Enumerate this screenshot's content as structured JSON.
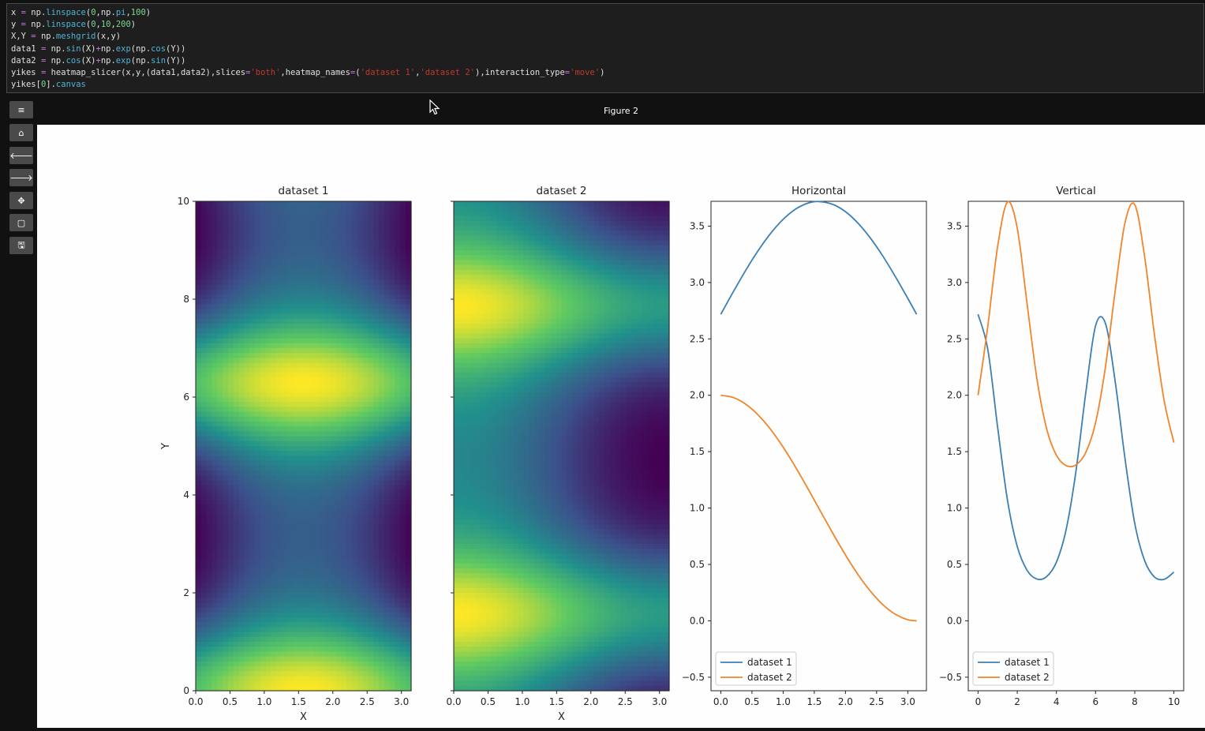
{
  "code_lines": [
    [
      [
        "x ",
        ""
      ],
      [
        "=",
        "op"
      ],
      [
        " np.",
        ""
      ],
      [
        "linspace",
        "fn"
      ],
      [
        "(",
        ""
      ],
      [
        "0",
        "num"
      ],
      [
        ",np.",
        ""
      ],
      [
        "pi",
        "fn"
      ],
      [
        ",",
        ""
      ],
      [
        "100",
        "num"
      ],
      [
        ")",
        ""
      ]
    ],
    [
      [
        "y ",
        ""
      ],
      [
        "=",
        "op"
      ],
      [
        " np.",
        ""
      ],
      [
        "linspace",
        "fn"
      ],
      [
        "(",
        ""
      ],
      [
        "0",
        "num"
      ],
      [
        ",",
        ""
      ],
      [
        "10",
        "num"
      ],
      [
        ",",
        ""
      ],
      [
        "200",
        "num"
      ],
      [
        ")",
        ""
      ]
    ],
    [
      [
        "X,Y ",
        ""
      ],
      [
        "=",
        "op"
      ],
      [
        " np.",
        ""
      ],
      [
        "meshgrid",
        "fn"
      ],
      [
        "(x,y)",
        ""
      ]
    ],
    [
      [
        "data1 ",
        ""
      ],
      [
        "=",
        "op"
      ],
      [
        " np.",
        ""
      ],
      [
        "sin",
        "fn"
      ],
      [
        "(X)",
        ""
      ],
      [
        "+",
        "op"
      ],
      [
        "np.",
        ""
      ],
      [
        "exp",
        "fn"
      ],
      [
        "(np.",
        ""
      ],
      [
        "cos",
        "fn"
      ],
      [
        "(Y))",
        ""
      ]
    ],
    [
      [
        "data2 ",
        ""
      ],
      [
        "=",
        "op"
      ],
      [
        " np.",
        ""
      ],
      [
        "cos",
        "fn"
      ],
      [
        "(X)",
        ""
      ],
      [
        "+",
        "op"
      ],
      [
        "np.",
        ""
      ],
      [
        "exp",
        "fn"
      ],
      [
        "(np.",
        ""
      ],
      [
        "sin",
        "fn"
      ],
      [
        "(Y))",
        ""
      ]
    ],
    [
      [
        "yikes ",
        ""
      ],
      [
        "=",
        "op"
      ],
      [
        " heatmap_slicer(x,y,(data1,data2),slices",
        ""
      ],
      [
        "=",
        "op"
      ],
      [
        "'both'",
        "str"
      ],
      [
        ",heatmap_names",
        ""
      ],
      [
        "=",
        "op"
      ],
      [
        "(",
        ""
      ],
      [
        "'dataset 1'",
        "str"
      ],
      [
        ",",
        ""
      ],
      [
        "'dataset 2'",
        "str"
      ],
      [
        "),interaction_type",
        ""
      ],
      [
        "=",
        "op"
      ],
      [
        "'move'",
        "str"
      ],
      [
        ")",
        ""
      ]
    ],
    [
      [
        "yikes[",
        ""
      ],
      [
        "0",
        "num"
      ],
      [
        "].",
        ""
      ],
      [
        "canvas",
        "fn"
      ]
    ]
  ],
  "figure": {
    "title": "Figure 2"
  },
  "toolbar": {
    "buttons": [
      {
        "name": "menu-button",
        "icon": "menu-icon",
        "glyph": "≡"
      },
      {
        "name": "home-button",
        "icon": "home-icon",
        "glyph": "⌂"
      },
      {
        "name": "back-button",
        "icon": "arrow-left-icon",
        "glyph": "🡐"
      },
      {
        "name": "forward-button",
        "icon": "arrow-right-icon",
        "glyph": "🡒"
      },
      {
        "name": "pan-button",
        "icon": "move-icon",
        "glyph": "✥"
      },
      {
        "name": "zoom-rect-button",
        "icon": "square-icon",
        "glyph": "▢"
      },
      {
        "name": "save-button",
        "icon": "floppy-disk-icon",
        "glyph": "🖫"
      }
    ]
  },
  "colors": {
    "dataset1": "#3b7fb5",
    "dataset2": "#f0852a",
    "viridis_low": "#440154",
    "viridis_high": "#fde725"
  },
  "chart_data": [
    {
      "type": "heatmap",
      "title": "dataset 1",
      "xlabel": "X",
      "ylabel": "Y",
      "function": "sin(X)+exp(cos(Y))",
      "xlim": [
        0,
        3.14159
      ],
      "ylim": [
        0,
        10
      ],
      "xticks": [
        "0.0",
        "0.5",
        "1.0",
        "1.5",
        "2.0",
        "2.5",
        "3.0"
      ],
      "yticks": [
        "0",
        "2",
        "4",
        "6",
        "8",
        "10"
      ],
      "colormap": "viridis"
    },
    {
      "type": "heatmap",
      "title": "dataset 2",
      "xlabel": "X",
      "ylabel": "",
      "function": "cos(X)+exp(sin(Y))",
      "xlim": [
        0,
        3.14159
      ],
      "ylim": [
        0,
        10
      ],
      "xticks": [
        "0.0",
        "0.5",
        "1.0",
        "1.5",
        "2.0",
        "2.5",
        "3.0"
      ],
      "yticks": [],
      "colormap": "viridis"
    },
    {
      "type": "line",
      "title": "Horizontal",
      "xlim": [
        -0.157,
        3.299
      ],
      "ylim": [
        -0.62,
        3.72
      ],
      "xticks": [
        "0.0",
        "0.5",
        "1.0",
        "1.5",
        "2.0",
        "2.5",
        "3.0"
      ],
      "yticks": [
        "−0.5",
        "0.0",
        "0.5",
        "1.0",
        "1.5",
        "2.0",
        "2.5",
        "3.0",
        "3.5"
      ],
      "legend": "lower-left",
      "series": [
        {
          "name": "dataset 1",
          "x": [
            0,
            0.2,
            0.4,
            0.6,
            0.8,
            1.0,
            1.2,
            1.4,
            1.5708,
            1.8,
            2.0,
            2.2,
            2.4,
            2.6,
            2.8,
            3.0,
            3.1416
          ],
          "y": [
            2.718,
            2.917,
            3.108,
            3.283,
            3.436,
            3.56,
            3.651,
            3.704,
            3.718,
            3.692,
            3.628,
            3.527,
            3.394,
            3.234,
            3.053,
            2.859,
            2.718
          ]
        },
        {
          "name": "dataset 2",
          "x": [
            0,
            0.2,
            0.4,
            0.6,
            0.8,
            1.0,
            1.2,
            1.4,
            1.5708,
            1.8,
            2.0,
            2.2,
            2.4,
            2.6,
            2.8,
            3.0,
            3.1416
          ],
          "y": [
            2.0,
            1.98,
            1.921,
            1.825,
            1.697,
            1.54,
            1.362,
            1.17,
            1.0,
            0.773,
            0.584,
            0.411,
            0.263,
            0.143,
            0.058,
            0.01,
            0.0
          ]
        }
      ]
    },
    {
      "type": "line",
      "title": "Vertical",
      "xlim": [
        -0.5,
        10.5
      ],
      "ylim": [
        -0.62,
        3.72
      ],
      "xticks": [
        "0",
        "2",
        "4",
        "6",
        "8",
        "10"
      ],
      "yticks": [
        "−0.5",
        "0.0",
        "0.5",
        "1.0",
        "1.5",
        "2.0",
        "2.5",
        "3.0",
        "3.5"
      ],
      "legend": "lower-left",
      "series": [
        {
          "name": "dataset 1",
          "x": [
            0,
            0.5,
            1.0,
            1.5,
            2.0,
            2.5,
            3.0,
            3.5,
            4.0,
            4.5,
            5.0,
            5.5,
            6.0,
            6.5,
            7.0,
            7.5,
            8.0,
            8.5,
            9.0,
            9.5,
            10.0
          ],
          "y": [
            2.718,
            2.405,
            1.716,
            1.073,
            0.66,
            0.449,
            0.371,
            0.392,
            0.52,
            0.811,
            1.328,
            2.022,
            2.617,
            2.639,
            2.125,
            1.443,
            0.865,
            0.537,
            0.39,
            0.368,
            0.432
          ]
        },
        {
          "name": "dataset 2",
          "x": [
            0,
            0.5,
            1.0,
            1.5,
            2.0,
            2.5,
            3.0,
            3.5,
            4.0,
            4.5,
            5.0,
            5.5,
            6.0,
            6.5,
            7.0,
            7.5,
            8.0,
            8.5,
            9.0,
            9.5,
            10.0
          ],
          "y": [
            2.0,
            2.616,
            3.32,
            3.713,
            3.483,
            2.817,
            2.152,
            1.704,
            1.469,
            1.376,
            1.383,
            1.493,
            1.756,
            2.246,
            2.923,
            3.527,
            3.691,
            3.235,
            2.546,
            1.954,
            1.58
          ]
        }
      ]
    }
  ]
}
